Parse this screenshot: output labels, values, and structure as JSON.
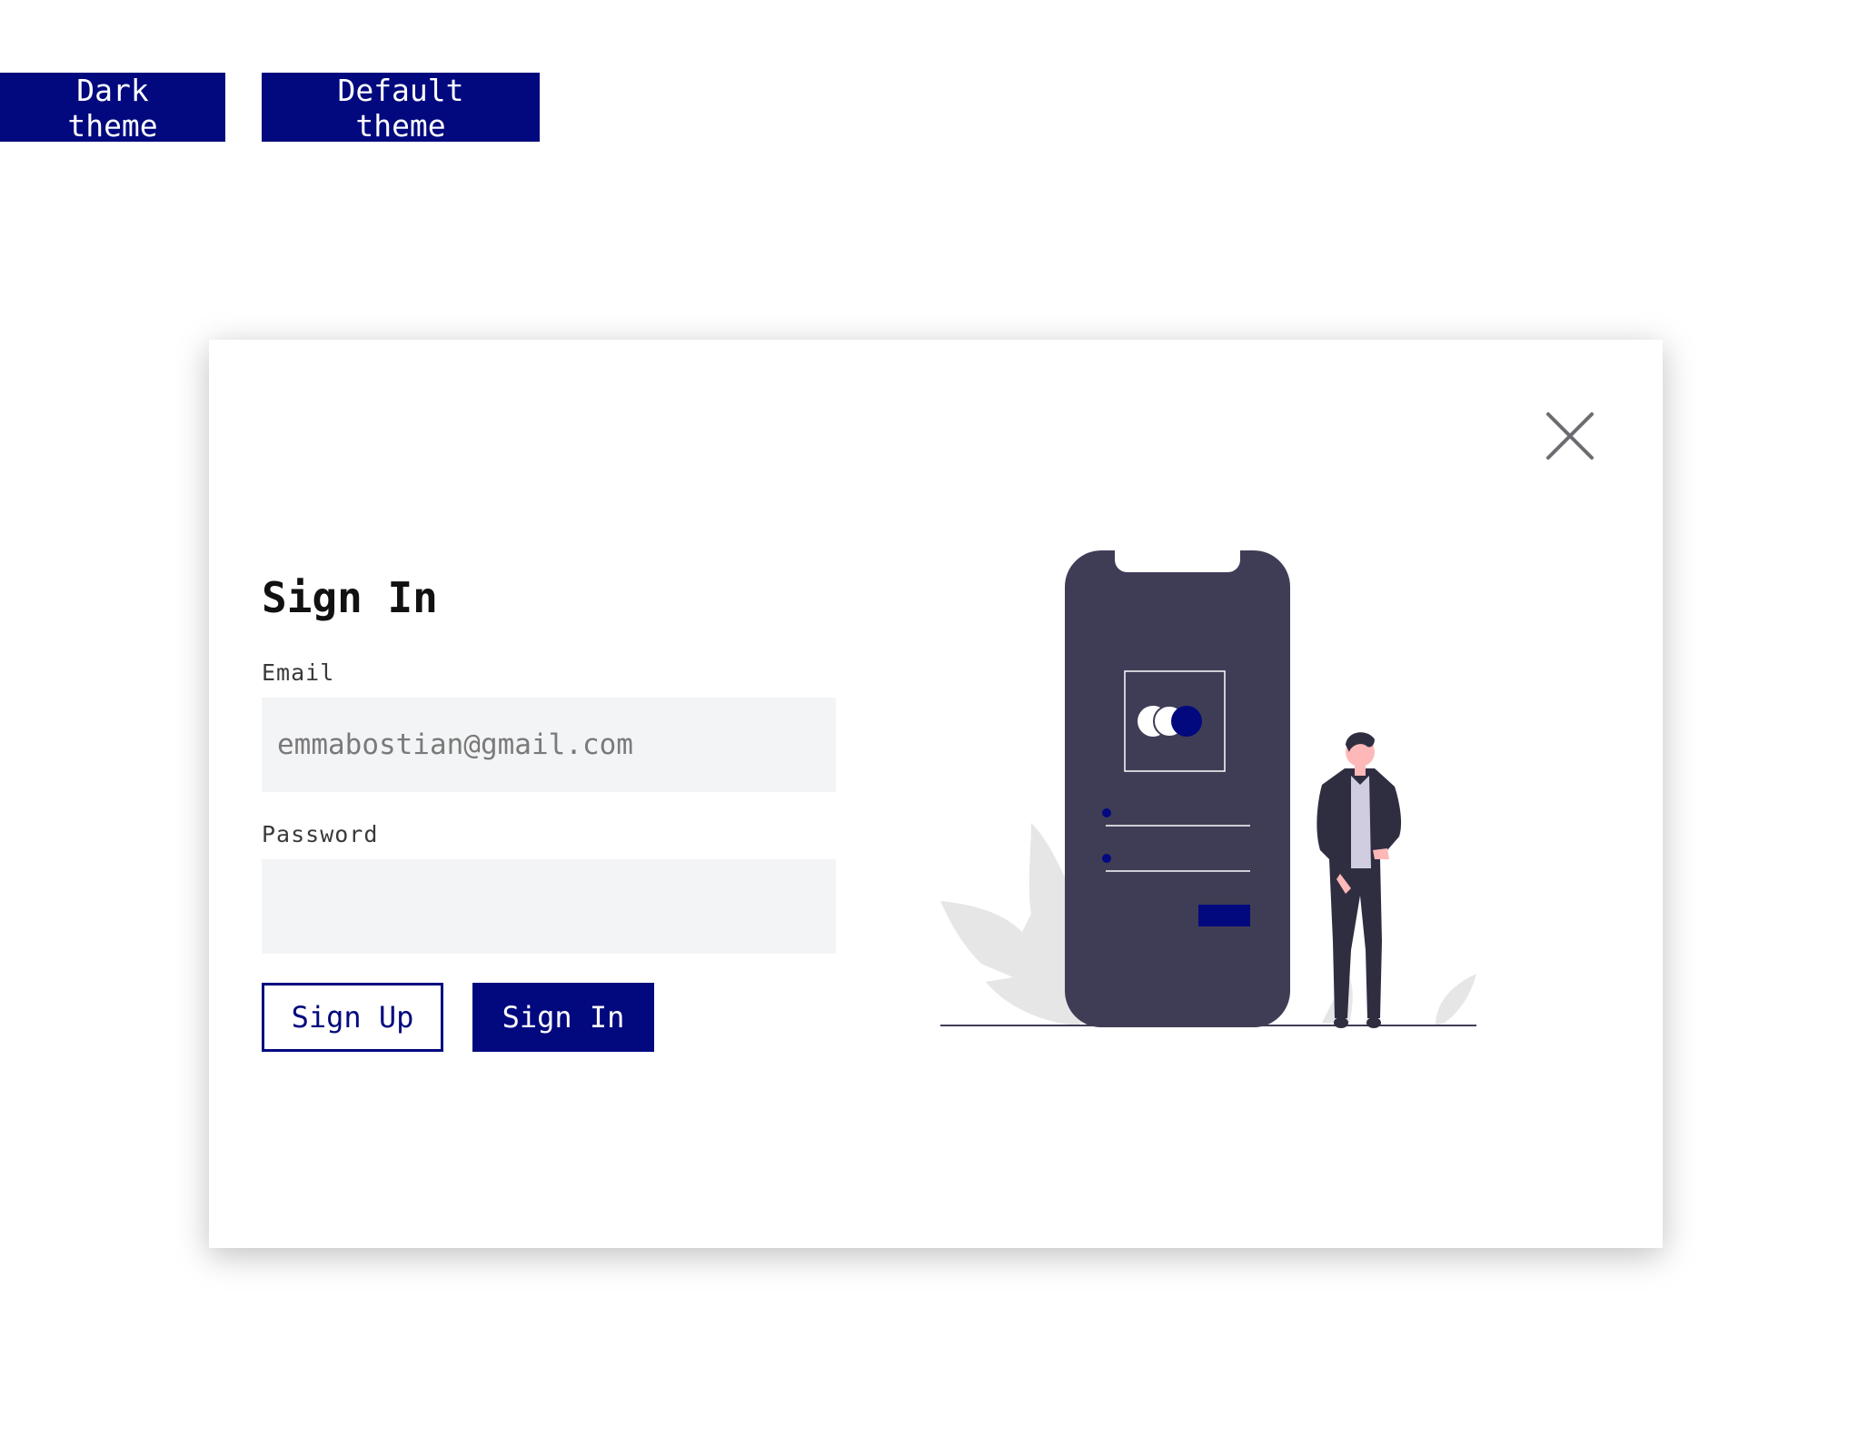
{
  "theme_buttons": {
    "dark_label": "Dark theme",
    "default_label": "Default theme"
  },
  "modal": {
    "title": "Sign In",
    "email": {
      "label": "Email",
      "placeholder": "emmabostian@gmail.com",
      "value": ""
    },
    "password": {
      "label": "Password",
      "placeholder": "",
      "value": ""
    },
    "sign_up_label": "Sign Up",
    "sign_in_label": "Sign In",
    "close_icon": "close-icon"
  },
  "colors": {
    "accent": "#02097e",
    "input_bg": "#f3f4f6",
    "phone_body": "#3f3d56"
  }
}
